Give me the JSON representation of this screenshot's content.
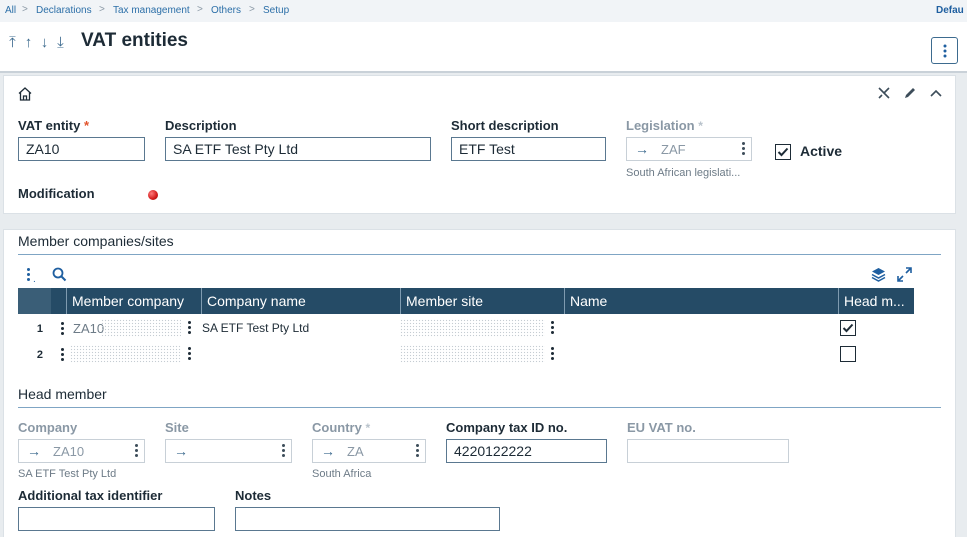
{
  "breadcrumb": {
    "items": [
      "All",
      "Declarations",
      "Tax management",
      "Others",
      "Setup"
    ],
    "right_label": "Defau"
  },
  "header": {
    "title": "VAT entities",
    "nav_icons": [
      "first-record-icon",
      "previous-record-icon",
      "next-record-icon",
      "last-record-icon"
    ]
  },
  "main": {
    "vat_entity": {
      "label": "VAT entity",
      "required_mark": "*",
      "value": "ZA10"
    },
    "description": {
      "label": "Description",
      "value": "SA ETF Test Pty Ltd"
    },
    "short_description": {
      "label": "Short description",
      "value": "ETF Test"
    },
    "legislation": {
      "label": "Legislation",
      "mark": "*",
      "value": "ZAF",
      "hint": "South African legislati..."
    },
    "active": {
      "label": "Active",
      "checked": true
    },
    "modification": {
      "label": "Modification",
      "status_color": "#d21a1a"
    }
  },
  "members": {
    "section_title": "Member companies/sites",
    "columns": [
      "Member company",
      "Company name",
      "Member site",
      "Name",
      "Head m..."
    ],
    "rows": [
      {
        "num": "1",
        "member_company": "ZA10",
        "company_name": "SA ETF Test Pty Ltd",
        "member_site": "",
        "name": "",
        "head_member": true
      },
      {
        "num": "2",
        "member_company": "",
        "company_name": "",
        "member_site": "",
        "name": "",
        "head_member": false
      }
    ]
  },
  "head_member": {
    "section_title": "Head member",
    "company": {
      "label": "Company",
      "value": "ZA10",
      "hint": "SA ETF Test Pty Ltd"
    },
    "site": {
      "label": "Site",
      "value": ""
    },
    "country": {
      "label": "Country",
      "mark": "*",
      "value": "ZA",
      "hint": "South Africa"
    },
    "company_tax_id": {
      "label": "Company tax ID no.",
      "value": "4220122222"
    },
    "eu_vat": {
      "label": "EU VAT no.",
      "value": ""
    },
    "additional_tax_identifier": {
      "label": "Additional tax identifier",
      "value": ""
    },
    "notes": {
      "label": "Notes",
      "value": ""
    }
  },
  "colors": {
    "accent": "#1f5fa0",
    "grid_header": "#254b66",
    "required": "#e2532c"
  }
}
